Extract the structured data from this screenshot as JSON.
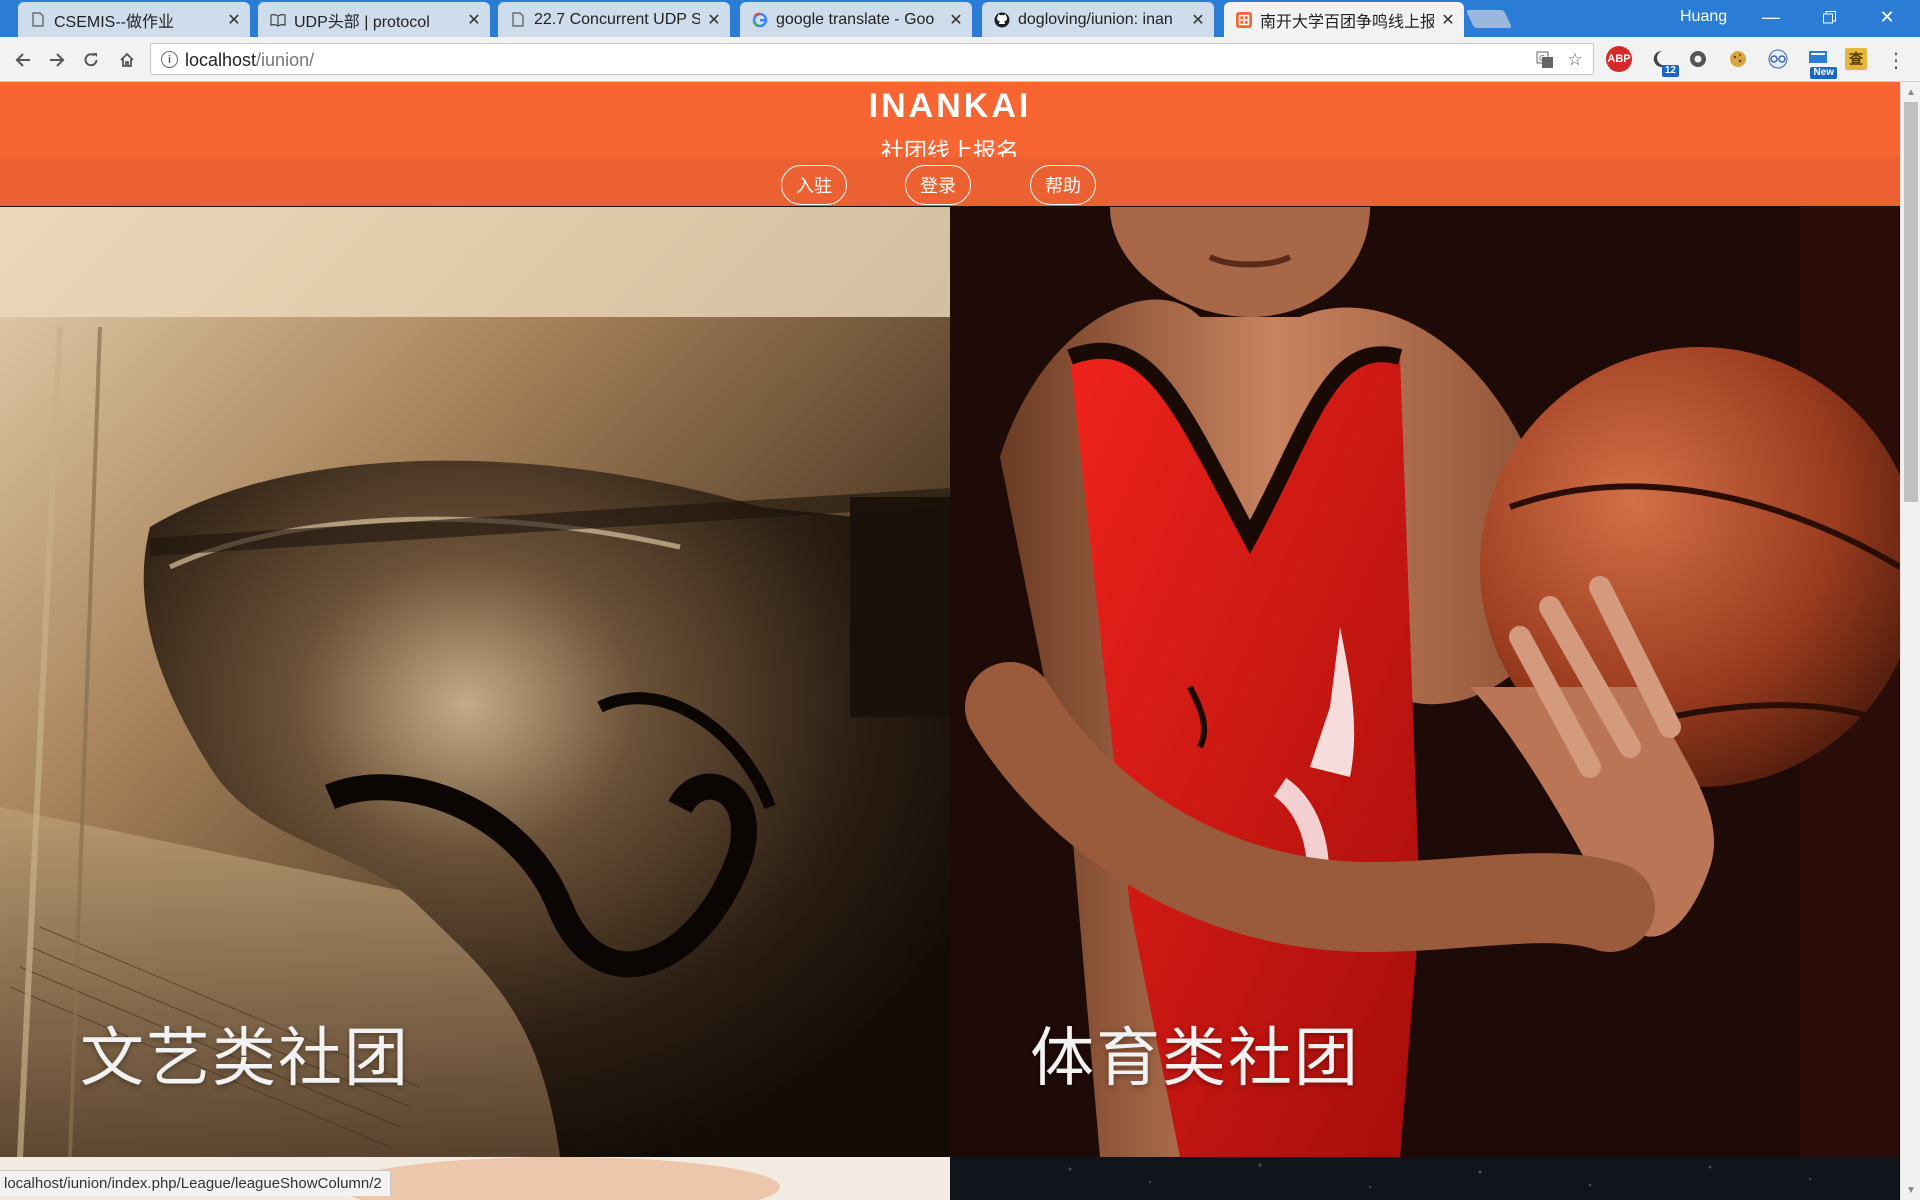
{
  "browser": {
    "tabs": [
      {
        "title": "CSEMIS--做作业",
        "icon": "page-icon"
      },
      {
        "title": "UDP头部 | protocol",
        "icon": "book-icon"
      },
      {
        "title": "22.7 Concurrent UDP S",
        "icon": "page-icon"
      },
      {
        "title": "google translate - Goo",
        "icon": "google-icon"
      },
      {
        "title": "dogloving/iunion: inan",
        "icon": "github-icon"
      },
      {
        "title": "南开大学百团争鸣线上报",
        "icon": "site-icon",
        "active": true
      }
    ],
    "profile_name": "Huang",
    "url_host": "localhost",
    "url_path": "/iunion/",
    "extensions": [
      {
        "name": "adblock-icon",
        "label": "ABP",
        "color": "#d42a2a"
      },
      {
        "name": "moon-extension-icon",
        "label": "",
        "badge": "12",
        "color": "#3b3b3b"
      },
      {
        "name": "settings-extension-icon",
        "label": "",
        "color": "#555555"
      },
      {
        "name": "cookie-extension-icon",
        "label": "",
        "color": "#d9a441"
      },
      {
        "name": "glasses-extension-icon",
        "label": "",
        "color": "#3a65a8"
      },
      {
        "name": "new-extension-icon",
        "label": "",
        "badge": "New",
        "color": "#2a7cd4"
      },
      {
        "name": "dictionary-extension-icon",
        "label": "查",
        "color": "#e2b73a"
      }
    ],
    "status_url": "localhost/iunion/index.php/League/leagueShowColumn/2"
  },
  "site": {
    "brand": "INANKAI",
    "subtitle": "社团线上报名",
    "nav": [
      "入驻",
      "登录",
      "帮助"
    ],
    "panels": [
      {
        "label": "文艺类社团"
      },
      {
        "label": "体育类社团"
      }
    ],
    "colors": {
      "header": "#f76532",
      "nav": "#ec6131"
    }
  }
}
